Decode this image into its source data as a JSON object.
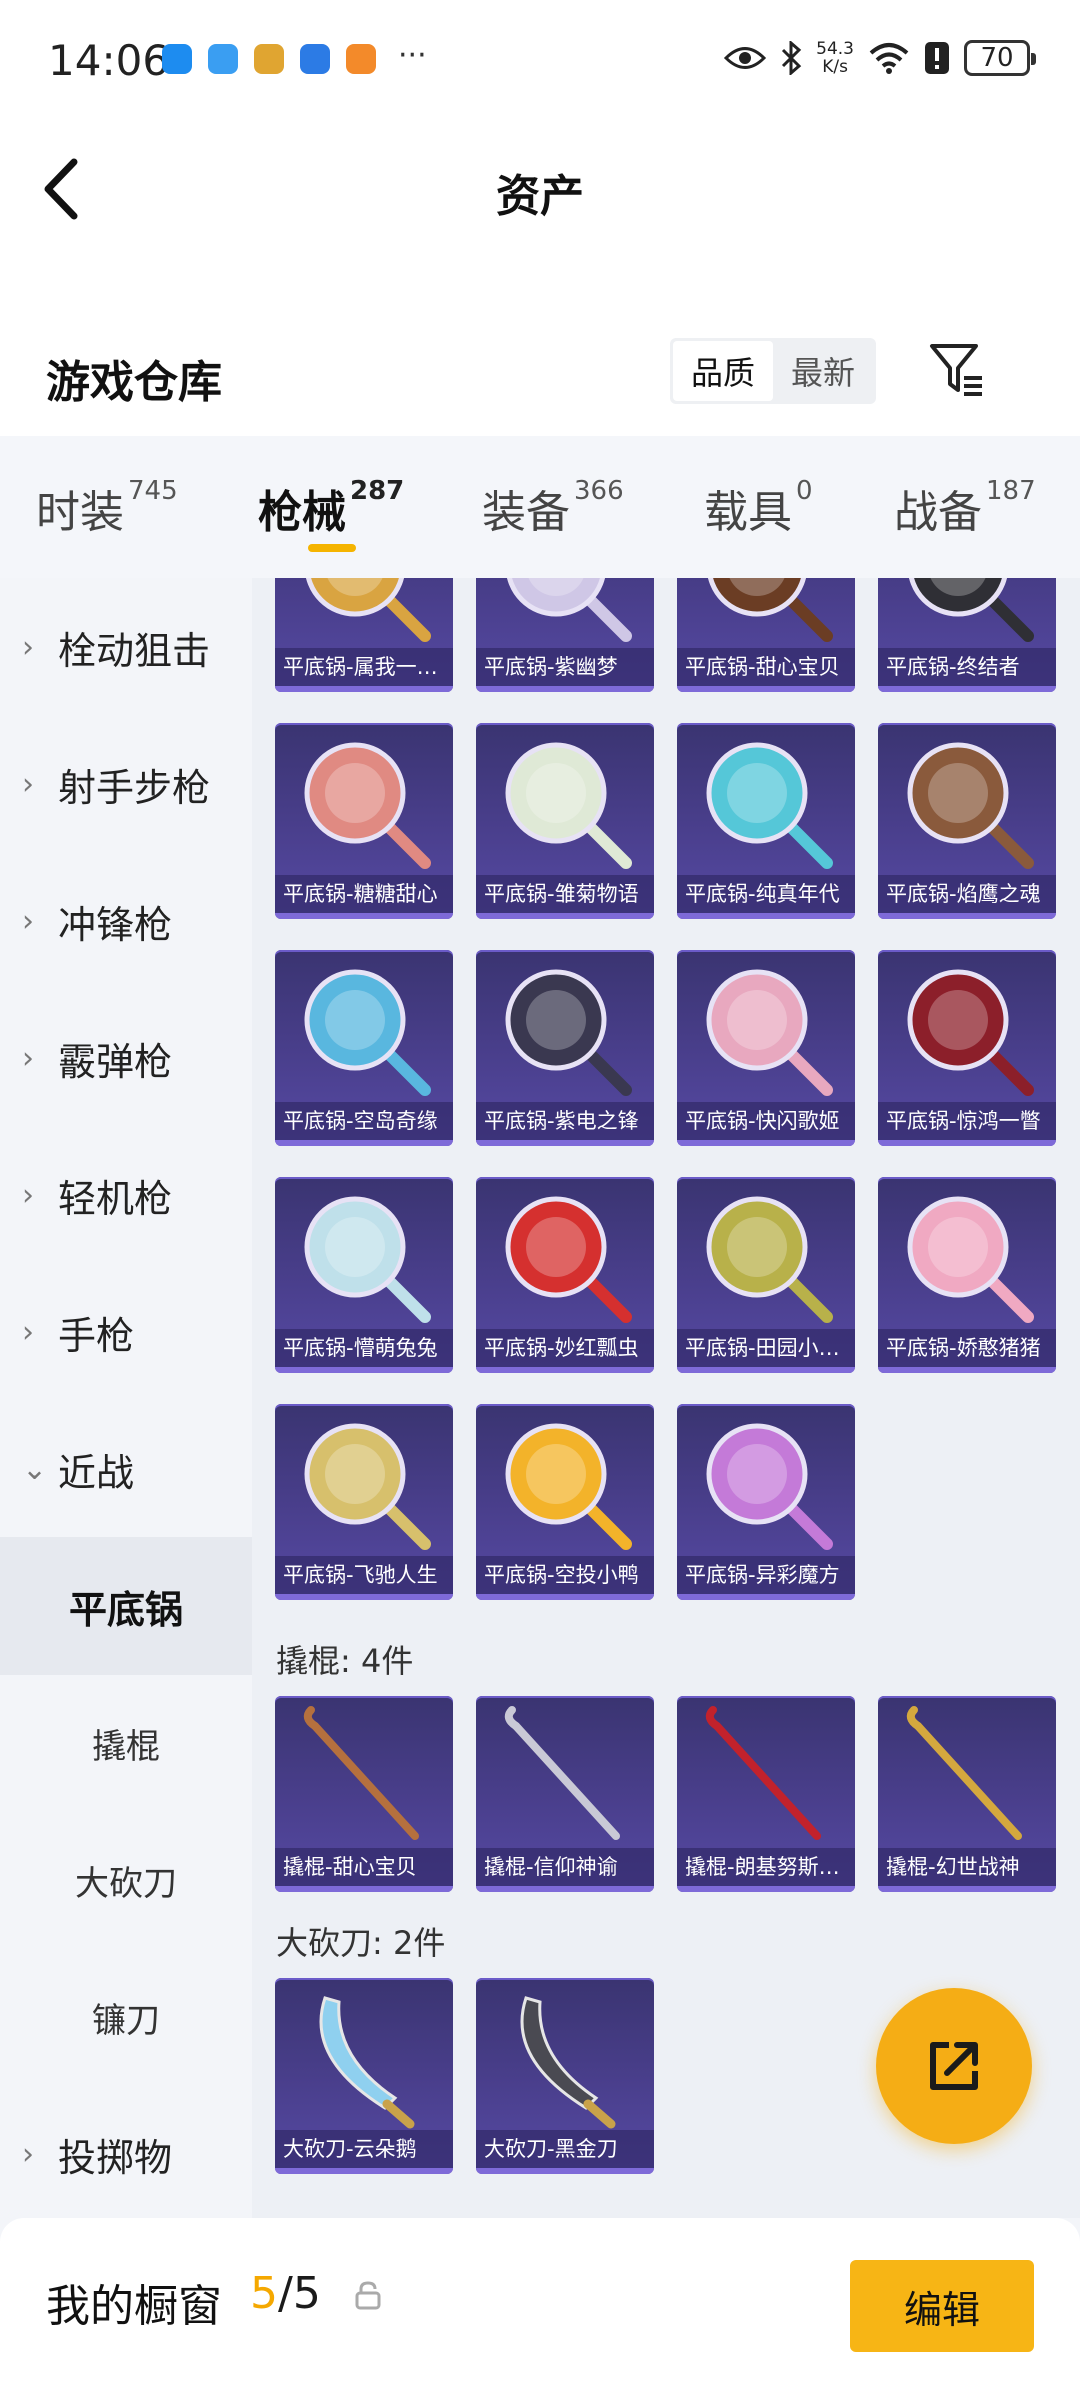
{
  "status_bar": {
    "time": "14:06",
    "speed_value": "54.3",
    "speed_unit": "K/s",
    "battery": "70",
    "app_icons": [
      {
        "name": "shield-app-icon",
        "color": "#1d8cf0"
      },
      {
        "name": "globe-app-icon",
        "color": "#3a9ef2"
      },
      {
        "name": "game-app-icon",
        "color": "#e0a531"
      },
      {
        "name": "bluetooth-app-icon",
        "color": "#2c7be5"
      },
      {
        "name": "controller-app-icon",
        "color": "#f38a2a"
      }
    ]
  },
  "header": {
    "title": "资产"
  },
  "warehouse": {
    "title": "游戏仓库",
    "sort_options": [
      "品质",
      "最新"
    ],
    "active_sort": 0
  },
  "tabs": [
    {
      "label": "时装",
      "count": "745"
    },
    {
      "label": "枪械",
      "count": "287",
      "active": true
    },
    {
      "label": "装备",
      "count": "366"
    },
    {
      "label": "载具",
      "count": "0"
    },
    {
      "label": "战备",
      "count": "187"
    }
  ],
  "sidebar": {
    "items": [
      {
        "label": "栓动狙击",
        "chevron": "›"
      },
      {
        "label": "射手步枪",
        "chevron": "›"
      },
      {
        "label": "冲锋枪",
        "chevron": "›"
      },
      {
        "label": "霰弹枪",
        "chevron": "›"
      },
      {
        "label": "轻机枪",
        "chevron": "›"
      },
      {
        "label": "手枪",
        "chevron": "›"
      },
      {
        "label": "近战",
        "chevron": "⌄"
      }
    ],
    "sub_items": [
      {
        "label": "平底锅",
        "active": true
      },
      {
        "label": "撬棍"
      },
      {
        "label": "大砍刀"
      },
      {
        "label": "镰刀"
      }
    ],
    "bottom_item": {
      "label": "投掷物",
      "chevron": "›"
    }
  },
  "content": {
    "pan_cards": [
      "平底锅-属我一枝花",
      "平底锅-紫幽梦",
      "平底锅-甜心宝贝",
      "平底锅-终结者",
      "平底锅-糖糖甜心",
      "平底锅-雏菊物语",
      "平底锅-纯真年代",
      "平底锅-焰鹰之魂",
      "平底锅-空岛奇缘",
      "平底锅-紫电之锋",
      "平底锅-快闪歌姬",
      "平底锅-惊鸿一瞥",
      "平底锅-懵萌兔兔",
      "平底锅-妙红瓢虫",
      "平底锅-田园小雏菊",
      "平底锅-娇憨猪猪",
      "平底锅-飞驰人生",
      "平底锅-空投小鸭",
      "平底锅-异彩魔方"
    ],
    "pan_card_colors": [
      "#d9a441",
      "#cfc7e6",
      "#6b3d24",
      "#2f2f35",
      "#e08a82",
      "#dfe9d6",
      "#55c7d8",
      "#8a5a3c",
      "#59b7df",
      "#3a3850",
      "#e8a8bf",
      "#8c1f2a",
      "#bfe0ea",
      "#d5302f",
      "#b8b14a",
      "#f0a9c2",
      "#d7c06c",
      "#f3b32a",
      "#c47ad8"
    ],
    "crowbar_group": {
      "label": "撬棍: 4件",
      "cards": [
        "撬棍-甜心宝贝",
        "撬棍-信仰神谕",
        "撬棍-朗基努斯之枪",
        "撬棍-幻世战神"
      ]
    },
    "machete_group": {
      "label": "大砍刀: 2件",
      "cards": [
        "大砍刀-云朵鹅",
        "大砍刀-黑金刀"
      ]
    }
  },
  "bottom_bar": {
    "title": "我的橱窗",
    "count_current": "5",
    "count_separator": "/",
    "count_total": "5",
    "edit_label": "编辑"
  }
}
